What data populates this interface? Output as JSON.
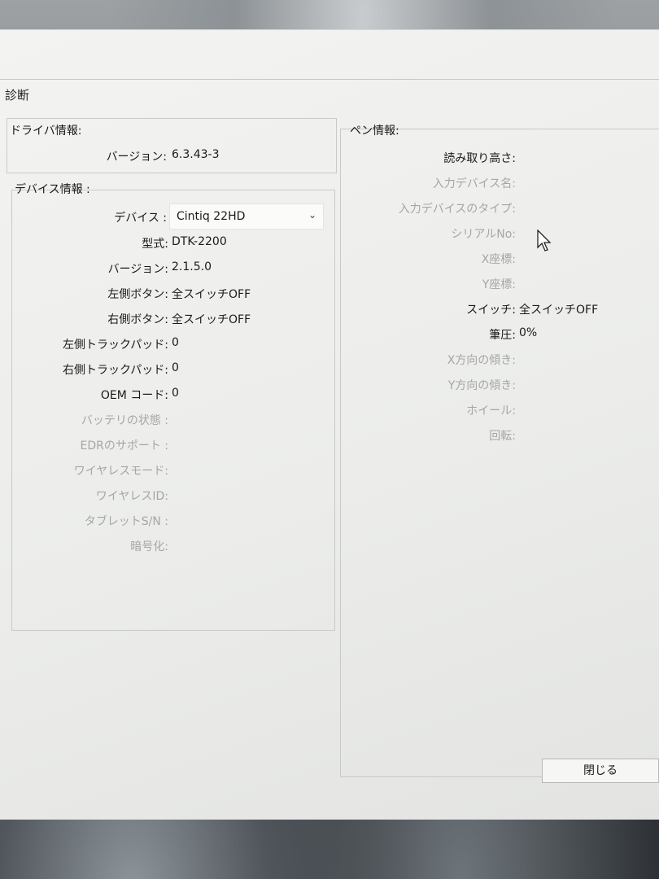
{
  "dialog": {
    "title": "診断",
    "close_label": "閉じる"
  },
  "driver_info": {
    "heading": "ドライバ情報:",
    "version_label": "バージョン:",
    "version_value": "6.3.43-3"
  },
  "device_info": {
    "heading": "デバイス情報 :",
    "device_label": "デバイス :",
    "device_selected": "Cintiq 22HD",
    "rows": [
      {
        "label": "型式:",
        "value": "DTK-2200",
        "enabled": true
      },
      {
        "label": "バージョン:",
        "value": "2.1.5.0",
        "enabled": true
      },
      {
        "label": "左側ボタン:",
        "value": "全スイッチOFF",
        "enabled": true
      },
      {
        "label": "右側ボタン:",
        "value": "全スイッチOFF",
        "enabled": true
      },
      {
        "label": "左側トラックパッド:",
        "value": "0",
        "enabled": true
      },
      {
        "label": "右側トラックパッド:",
        "value": "0",
        "enabled": true
      },
      {
        "label": "OEM コード:",
        "value": "0",
        "enabled": true
      },
      {
        "label": "バッテリの状態 :",
        "value": "",
        "enabled": false
      },
      {
        "label": "EDRのサポート :",
        "value": "",
        "enabled": false
      },
      {
        "label": "ワイヤレスモード:",
        "value": "",
        "enabled": false
      },
      {
        "label": "ワイヤレスID:",
        "value": "",
        "enabled": false
      },
      {
        "label": "タブレットS/N :",
        "value": "",
        "enabled": false
      },
      {
        "label": "暗号化:",
        "value": "",
        "enabled": false
      }
    ]
  },
  "pen_info": {
    "heading": "ペン情報:",
    "rows": [
      {
        "label": "読み取り高さ:",
        "value": "",
        "enabled": true
      },
      {
        "label": "入力デバイス名:",
        "value": "",
        "enabled": false
      },
      {
        "label": "入力デバイスのタイプ:",
        "value": "",
        "enabled": false
      },
      {
        "label": "シリアルNo:",
        "value": "",
        "enabled": false
      },
      {
        "label": "X座標:",
        "value": "",
        "enabled": false
      },
      {
        "label": "Y座標:",
        "value": "",
        "enabled": false
      },
      {
        "label": "スイッチ:",
        "value": "全スイッチOFF",
        "enabled": true
      },
      {
        "label": "筆圧:",
        "value": "0%",
        "enabled": true
      },
      {
        "label": "X方向の傾き:",
        "value": "",
        "enabled": false
      },
      {
        "label": "Y方向の傾き:",
        "value": "",
        "enabled": false
      },
      {
        "label": "ホイール:",
        "value": "",
        "enabled": false
      },
      {
        "label": "回転:",
        "value": "",
        "enabled": false
      }
    ]
  }
}
